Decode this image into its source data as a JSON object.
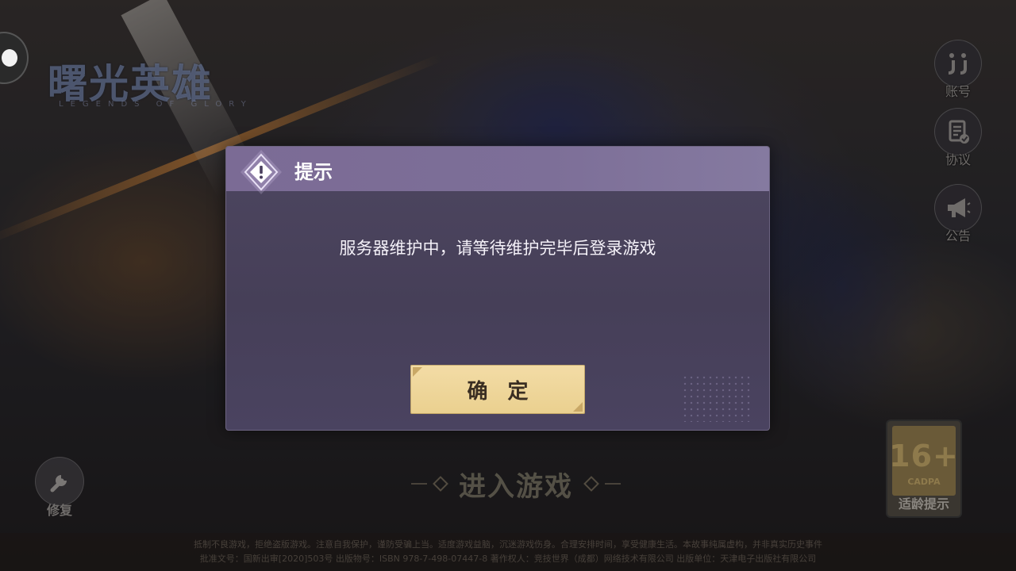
{
  "game": {
    "logo_title": "曙光英雄",
    "logo_subtitle": "LEGENDS OF GLORY"
  },
  "side_menu": {
    "account_label": "账号",
    "account_icon": "jj-logo-icon",
    "agreement_label": "协议",
    "agreement_icon": "document-check-icon",
    "notice_label": "公告",
    "notice_icon": "megaphone-icon"
  },
  "repair": {
    "label": "修复",
    "icon": "wrench-icon"
  },
  "enter_game": {
    "label": "进入游戏"
  },
  "age_rating": {
    "age": "16+",
    "org": "CADPA",
    "caption": "适龄提示"
  },
  "bottom_notice": {
    "line1": "抵制不良游戏，拒绝盗版游戏。注意自我保护，谨防受骗上当。适度游戏益脑，沉迷游戏伤身。合理安排时间，享受健康生活。本故事纯属虚构，并非真实历史事件",
    "line2": "批准文号：国新出审[2020]503号  出版物号：ISBN 978-7-498-07447-8  著作权人：竞技世界（成都）网络技术有限公司  出版单位：天津电子出版社有限公司"
  },
  "dialog": {
    "title": "提示",
    "message": "服务器维护中，请等待维护完毕后登录游戏",
    "confirm_label": "确 定",
    "colors": {
      "header": "#7b6b95",
      "body": "#4a4360",
      "button": "#f3dca6"
    }
  }
}
